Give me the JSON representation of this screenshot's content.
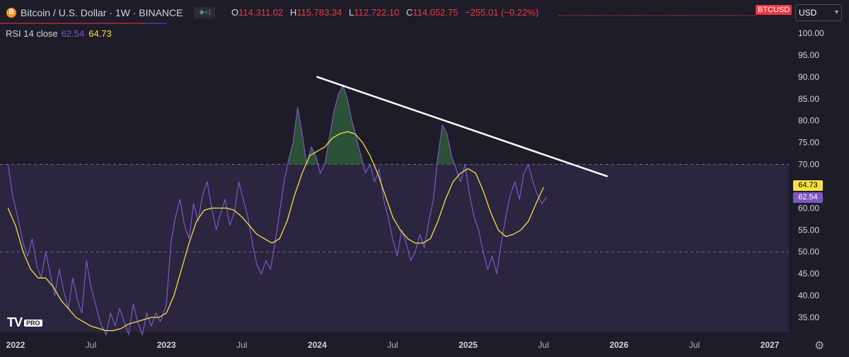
{
  "header": {
    "symbol_icon": "B",
    "symbol_title": "Bitcoin / U.S. Dollar · 1W · BINANCE",
    "indicator_icon": "indicator-icon",
    "ohlc": {
      "o_key": "O",
      "o_val": "114,311.02",
      "h_key": "H",
      "h_val": "115,783.34",
      "l_key": "L",
      "l_val": "112,722.10",
      "c_key": "C",
      "c_val": "114,052.75",
      "change": "−255.01 (−0.22%)"
    },
    "symbol_badge": "BTCUSD",
    "currency": "USD"
  },
  "indicator_legend": {
    "name": "RSI 14 close",
    "rsi_value": "62.54",
    "ma_value": "64.73"
  },
  "logo": {
    "tv": "TV",
    "pro": "PRO"
  },
  "colors": {
    "background": "#1d1c28",
    "band": "#2b2540",
    "rsi_line": "#7e57c2",
    "ma_line": "#f5e142",
    "trendline": "#ffffff",
    "overbought_fill": "#2e5b3a",
    "down": "#f23645"
  },
  "chart_data": {
    "type": "line",
    "title": "RSI 14 close",
    "x_axis": {
      "labels": [
        "2022",
        "Jul",
        "2023",
        "Jul",
        "2024",
        "Jul",
        "2025",
        "Jul",
        "2026",
        "Jul",
        "2027"
      ]
    },
    "y_axis": {
      "ticks": [
        "35.00",
        "40.00",
        "45.00",
        "50.00",
        "55.00",
        "60.00",
        "65.00",
        "70.00",
        "75.00",
        "80.00",
        "85.00",
        "90.00",
        "95.00",
        "100.00"
      ],
      "range": [
        32,
        102
      ]
    },
    "levels": {
      "overbought": 70,
      "oversold": 50
    },
    "x_range": [
      2021.95,
      2027.45
    ],
    "series": [
      {
        "name": "RSI",
        "color": "#7e57c2",
        "points": [
          [
            2021.95,
            70
          ],
          [
            2021.98,
            63
          ],
          [
            2022.02,
            57
          ],
          [
            2022.05,
            52
          ],
          [
            2022.08,
            49
          ],
          [
            2022.11,
            53
          ],
          [
            2022.14,
            47
          ],
          [
            2022.17,
            44
          ],
          [
            2022.2,
            50
          ],
          [
            2022.23,
            45
          ],
          [
            2022.26,
            40
          ],
          [
            2022.29,
            46
          ],
          [
            2022.32,
            41
          ],
          [
            2022.35,
            37
          ],
          [
            2022.38,
            44
          ],
          [
            2022.41,
            39
          ],
          [
            2022.44,
            36
          ],
          [
            2022.47,
            48
          ],
          [
            2022.5,
            42
          ],
          [
            2022.53,
            38
          ],
          [
            2022.56,
            34
          ],
          [
            2022.6,
            31
          ],
          [
            2022.63,
            36
          ],
          [
            2022.66,
            33
          ],
          [
            2022.69,
            37
          ],
          [
            2022.72,
            34
          ],
          [
            2022.75,
            31
          ],
          [
            2022.78,
            38
          ],
          [
            2022.81,
            34
          ],
          [
            2022.84,
            31
          ],
          [
            2022.87,
            36
          ],
          [
            2022.9,
            33
          ],
          [
            2022.93,
            36
          ],
          [
            2022.96,
            34
          ],
          [
            2023.0,
            38
          ],
          [
            2023.03,
            52
          ],
          [
            2023.06,
            58
          ],
          [
            2023.09,
            62
          ],
          [
            2023.12,
            56
          ],
          [
            2023.15,
            53
          ],
          [
            2023.18,
            61
          ],
          [
            2023.21,
            57
          ],
          [
            2023.24,
            63
          ],
          [
            2023.27,
            66
          ],
          [
            2023.3,
            60
          ],
          [
            2023.33,
            55
          ],
          [
            2023.36,
            59
          ],
          [
            2023.39,
            62
          ],
          [
            2023.42,
            56
          ],
          [
            2023.45,
            59
          ],
          [
            2023.48,
            66
          ],
          [
            2023.51,
            62
          ],
          [
            2023.54,
            58
          ],
          [
            2023.57,
            52
          ],
          [
            2023.6,
            47
          ],
          [
            2023.63,
            45
          ],
          [
            2023.66,
            48
          ],
          [
            2023.69,
            46
          ],
          [
            2023.72,
            52
          ],
          [
            2023.75,
            59
          ],
          [
            2023.78,
            66
          ],
          [
            2023.81,
            71
          ],
          [
            2023.84,
            75
          ],
          [
            2023.87,
            83
          ],
          [
            2023.9,
            77
          ],
          [
            2023.93,
            70
          ],
          [
            2023.96,
            74
          ],
          [
            2023.99,
            72
          ],
          [
            2024.02,
            68
          ],
          [
            2024.05,
            70
          ],
          [
            2024.08,
            76
          ],
          [
            2024.11,
            82
          ],
          [
            2024.14,
            86
          ],
          [
            2024.17,
            88
          ],
          [
            2024.2,
            85
          ],
          [
            2024.23,
            80
          ],
          [
            2024.26,
            76
          ],
          [
            2024.29,
            72
          ],
          [
            2024.32,
            68
          ],
          [
            2024.35,
            70
          ],
          [
            2024.38,
            66
          ],
          [
            2024.41,
            69
          ],
          [
            2024.44,
            62
          ],
          [
            2024.47,
            58
          ],
          [
            2024.5,
            53
          ],
          [
            2024.53,
            49
          ],
          [
            2024.56,
            55
          ],
          [
            2024.59,
            52
          ],
          [
            2024.62,
            48
          ],
          [
            2024.65,
            50
          ],
          [
            2024.68,
            54
          ],
          [
            2024.71,
            51
          ],
          [
            2024.74,
            57
          ],
          [
            2024.77,
            62
          ],
          [
            2024.8,
            72
          ],
          [
            2024.83,
            79
          ],
          [
            2024.86,
            77
          ],
          [
            2024.89,
            72
          ],
          [
            2024.92,
            69
          ],
          [
            2024.95,
            66
          ],
          [
            2024.98,
            70
          ],
          [
            2025.01,
            63
          ],
          [
            2025.04,
            58
          ],
          [
            2025.07,
            55
          ],
          [
            2025.1,
            50
          ],
          [
            2025.13,
            46
          ],
          [
            2025.16,
            49
          ],
          [
            2025.19,
            45
          ],
          [
            2025.22,
            52
          ],
          [
            2025.25,
            58
          ],
          [
            2025.28,
            63
          ],
          [
            2025.31,
            66
          ],
          [
            2025.34,
            62
          ],
          [
            2025.37,
            68
          ],
          [
            2025.4,
            70
          ],
          [
            2025.43,
            66
          ],
          [
            2025.46,
            63
          ],
          [
            2025.49,
            61
          ],
          [
            2025.52,
            62.54
          ]
        ]
      },
      {
        "name": "RSI-based MA",
        "color": "#f5e142",
        "points": [
          [
            2021.95,
            60
          ],
          [
            2022.0,
            56
          ],
          [
            2022.05,
            50
          ],
          [
            2022.1,
            46
          ],
          [
            2022.15,
            44
          ],
          [
            2022.2,
            44
          ],
          [
            2022.25,
            42
          ],
          [
            2022.3,
            39
          ],
          [
            2022.35,
            37
          ],
          [
            2022.4,
            35
          ],
          [
            2022.45,
            34
          ],
          [
            2022.5,
            33
          ],
          [
            2022.55,
            32.5
          ],
          [
            2022.6,
            32
          ],
          [
            2022.65,
            32
          ],
          [
            2022.7,
            32.5
          ],
          [
            2022.75,
            33.5
          ],
          [
            2022.8,
            34
          ],
          [
            2022.85,
            34.5
          ],
          [
            2022.9,
            35
          ],
          [
            2022.95,
            35
          ],
          [
            2023.0,
            36
          ],
          [
            2023.05,
            40
          ],
          [
            2023.1,
            46
          ],
          [
            2023.15,
            52
          ],
          [
            2023.2,
            57
          ],
          [
            2023.25,
            59.5
          ],
          [
            2023.3,
            60
          ],
          [
            2023.35,
            60
          ],
          [
            2023.4,
            60
          ],
          [
            2023.45,
            59.5
          ],
          [
            2023.5,
            58
          ],
          [
            2023.55,
            56
          ],
          [
            2023.6,
            54
          ],
          [
            2023.65,
            53
          ],
          [
            2023.7,
            52
          ],
          [
            2023.75,
            53
          ],
          [
            2023.8,
            57
          ],
          [
            2023.85,
            63
          ],
          [
            2023.9,
            68
          ],
          [
            2023.95,
            72
          ],
          [
            2024.0,
            73
          ],
          [
            2024.05,
            74
          ],
          [
            2024.1,
            76
          ],
          [
            2024.15,
            77
          ],
          [
            2024.2,
            77.5
          ],
          [
            2024.25,
            77
          ],
          [
            2024.3,
            75
          ],
          [
            2024.35,
            72
          ],
          [
            2024.4,
            68
          ],
          [
            2024.45,
            63
          ],
          [
            2024.5,
            58
          ],
          [
            2024.55,
            55
          ],
          [
            2024.6,
            53
          ],
          [
            2024.65,
            52
          ],
          [
            2024.7,
            52
          ],
          [
            2024.75,
            53
          ],
          [
            2024.8,
            57
          ],
          [
            2024.85,
            62
          ],
          [
            2024.9,
            66
          ],
          [
            2024.95,
            68
          ],
          [
            2025.0,
            69
          ],
          [
            2025.05,
            68
          ],
          [
            2025.1,
            64
          ],
          [
            2025.15,
            59
          ],
          [
            2025.2,
            55
          ],
          [
            2025.25,
            53.5
          ],
          [
            2025.3,
            54
          ],
          [
            2025.35,
            55
          ],
          [
            2025.4,
            57
          ],
          [
            2025.45,
            61
          ],
          [
            2025.5,
            64.73
          ]
        ]
      }
    ],
    "trendline": {
      "from": [
        2024.0,
        90.0
      ],
      "to": [
        2025.92,
        67.3
      ]
    },
    "last_values": {
      "ma": "64.73",
      "rsi": "62.54"
    }
  }
}
